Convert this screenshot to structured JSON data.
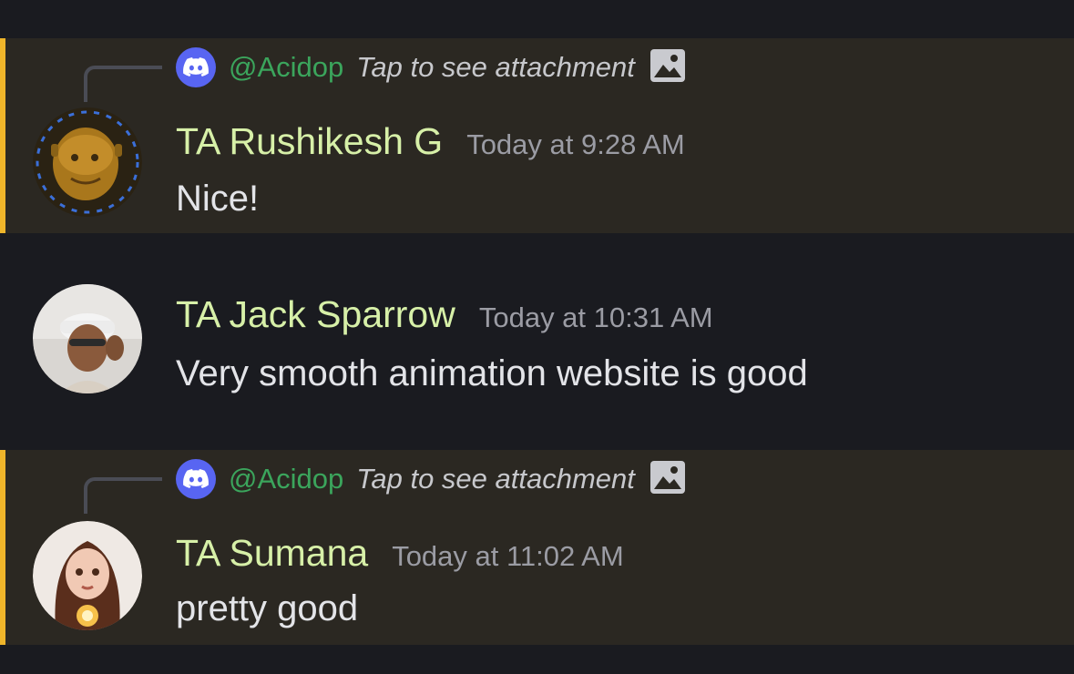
{
  "colors": {
    "background": "#1a1b20",
    "mention_background": "#2b2822",
    "mention_accent": "#efb52a",
    "author_name": "#d7f0a8",
    "timestamp": "#9b9ca4",
    "reply_mention": "#3ba55c",
    "discord_blurple": "#5865f2"
  },
  "messages": [
    {
      "highlighted": true,
      "reply": {
        "avatar_icon": "discord-logo-icon",
        "mention": "@Acidop",
        "text": "Tap to see attachment",
        "attachment_icon": "image-icon"
      },
      "avatar": "shrek-avatar",
      "author": "TA Rushikesh G",
      "timestamp": "Today at 9:28 AM",
      "content": "Nice!"
    },
    {
      "highlighted": false,
      "avatar": "cap-wearing-man-avatar",
      "author": "TA Jack Sparrow",
      "timestamp": "Today at 10:31 AM",
      "content": "Very smooth animation website is good"
    },
    {
      "highlighted": true,
      "reply": {
        "avatar_icon": "discord-logo-icon",
        "mention": "@Acidop",
        "text": "Tap to see attachment",
        "attachment_icon": "image-icon"
      },
      "avatar": "girl-with-candle-avatar",
      "author": "TA Sumana",
      "timestamp": "Today at 11:02 AM",
      "content": "pretty good"
    }
  ]
}
